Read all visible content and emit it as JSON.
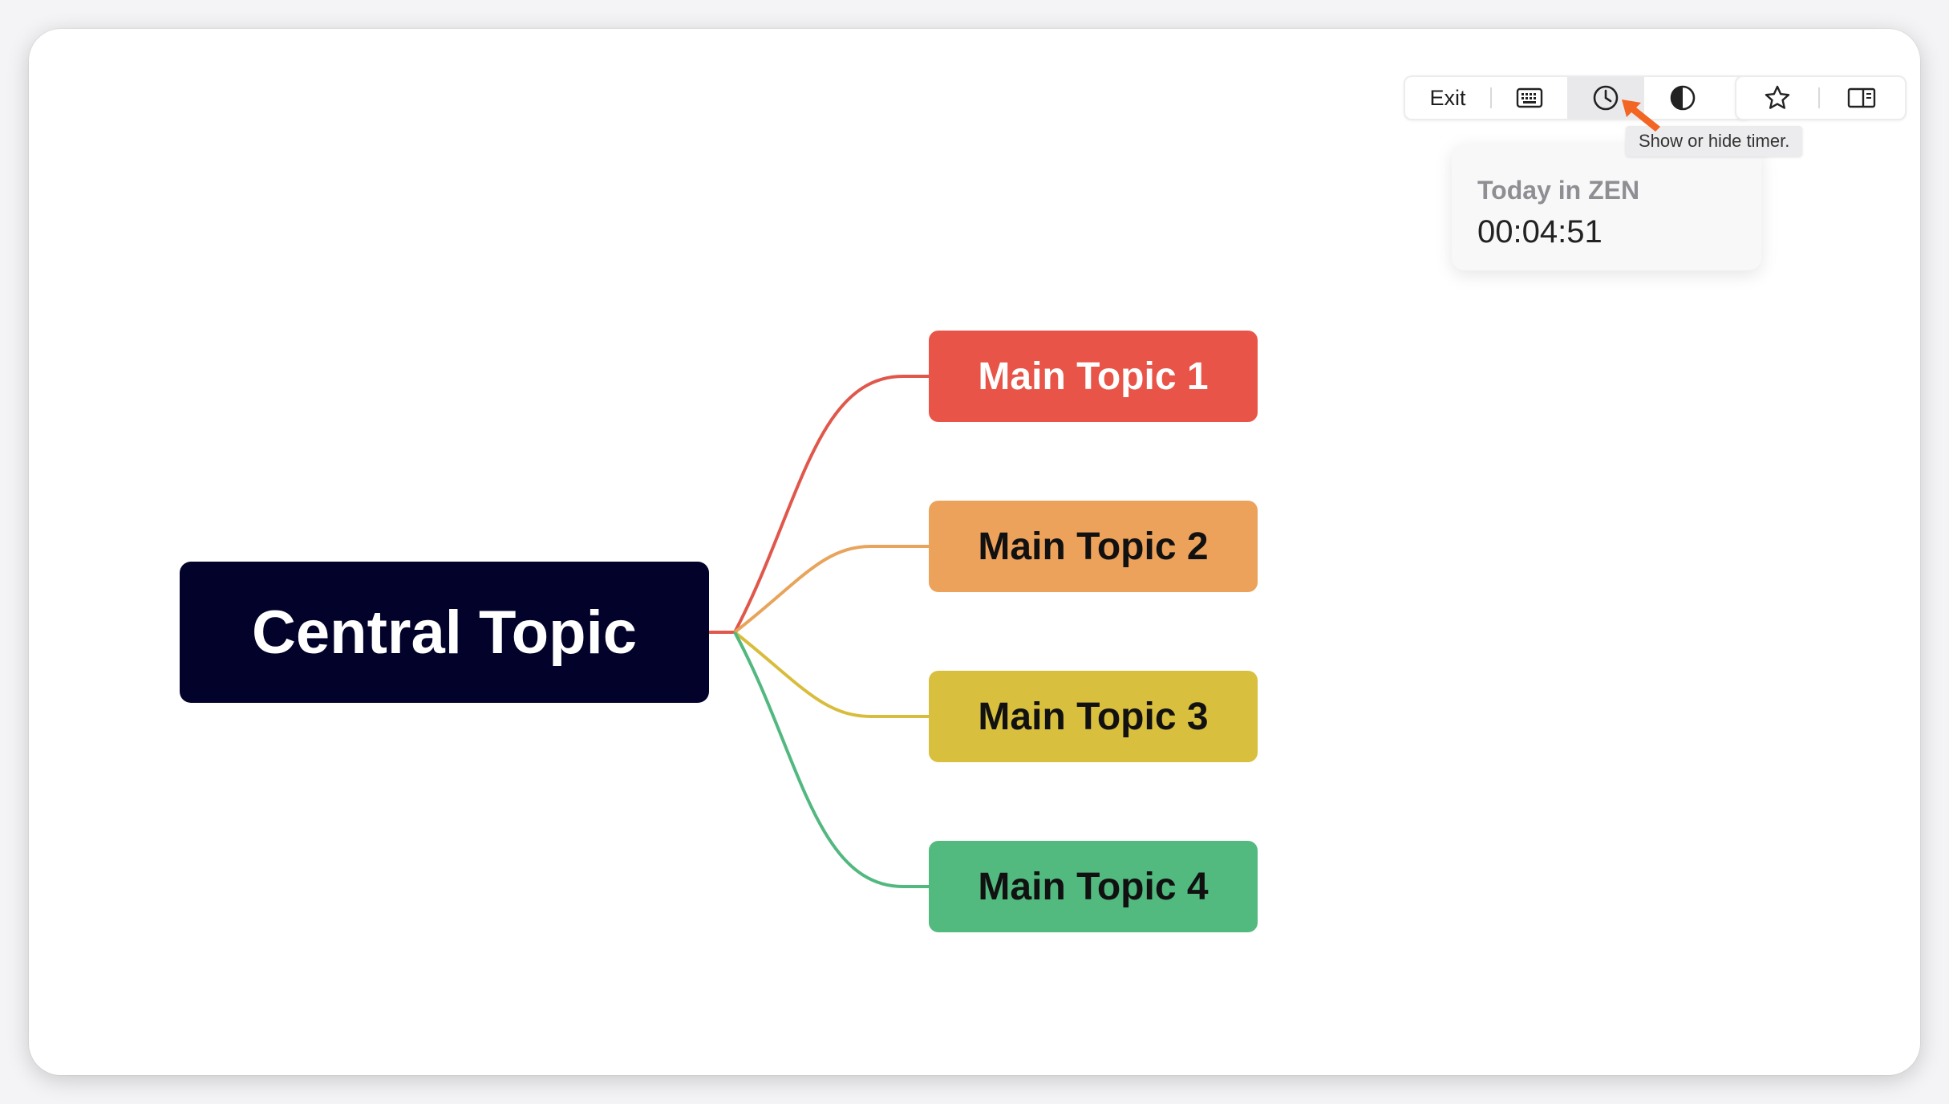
{
  "toolbar": {
    "exit_label": "Exit",
    "buttons": [
      {
        "icon": "keyboard-icon"
      },
      {
        "icon": "clock-icon"
      },
      {
        "icon": "contrast-icon"
      },
      {
        "icon": "star-icon"
      },
      {
        "icon": "sidebar-panel-icon"
      }
    ]
  },
  "tooltip": {
    "text": "Show or hide timer."
  },
  "timer": {
    "title": "Today in ZEN",
    "value": "00:04:51"
  },
  "mindmap": {
    "central": {
      "label": "Central Topic",
      "color": "#02022a",
      "text_color": "#ffffff"
    },
    "topics": [
      {
        "label": "Main Topic 1",
        "color": "#e85448",
        "text_color": "#ffffff",
        "line_color": "#e0574b"
      },
      {
        "label": "Main Topic 2",
        "color": "#eca25b",
        "text_color": "#111111",
        "line_color": "#e8a45c"
      },
      {
        "label": "Main Topic 3",
        "color": "#d9bf3e",
        "text_color": "#111111",
        "line_color": "#d8bd3d"
      },
      {
        "label": "Main Topic 4",
        "color": "#52b97f",
        "text_color": "#111111",
        "line_color": "#52b880"
      }
    ]
  },
  "pointer": {
    "color": "#f26522"
  }
}
